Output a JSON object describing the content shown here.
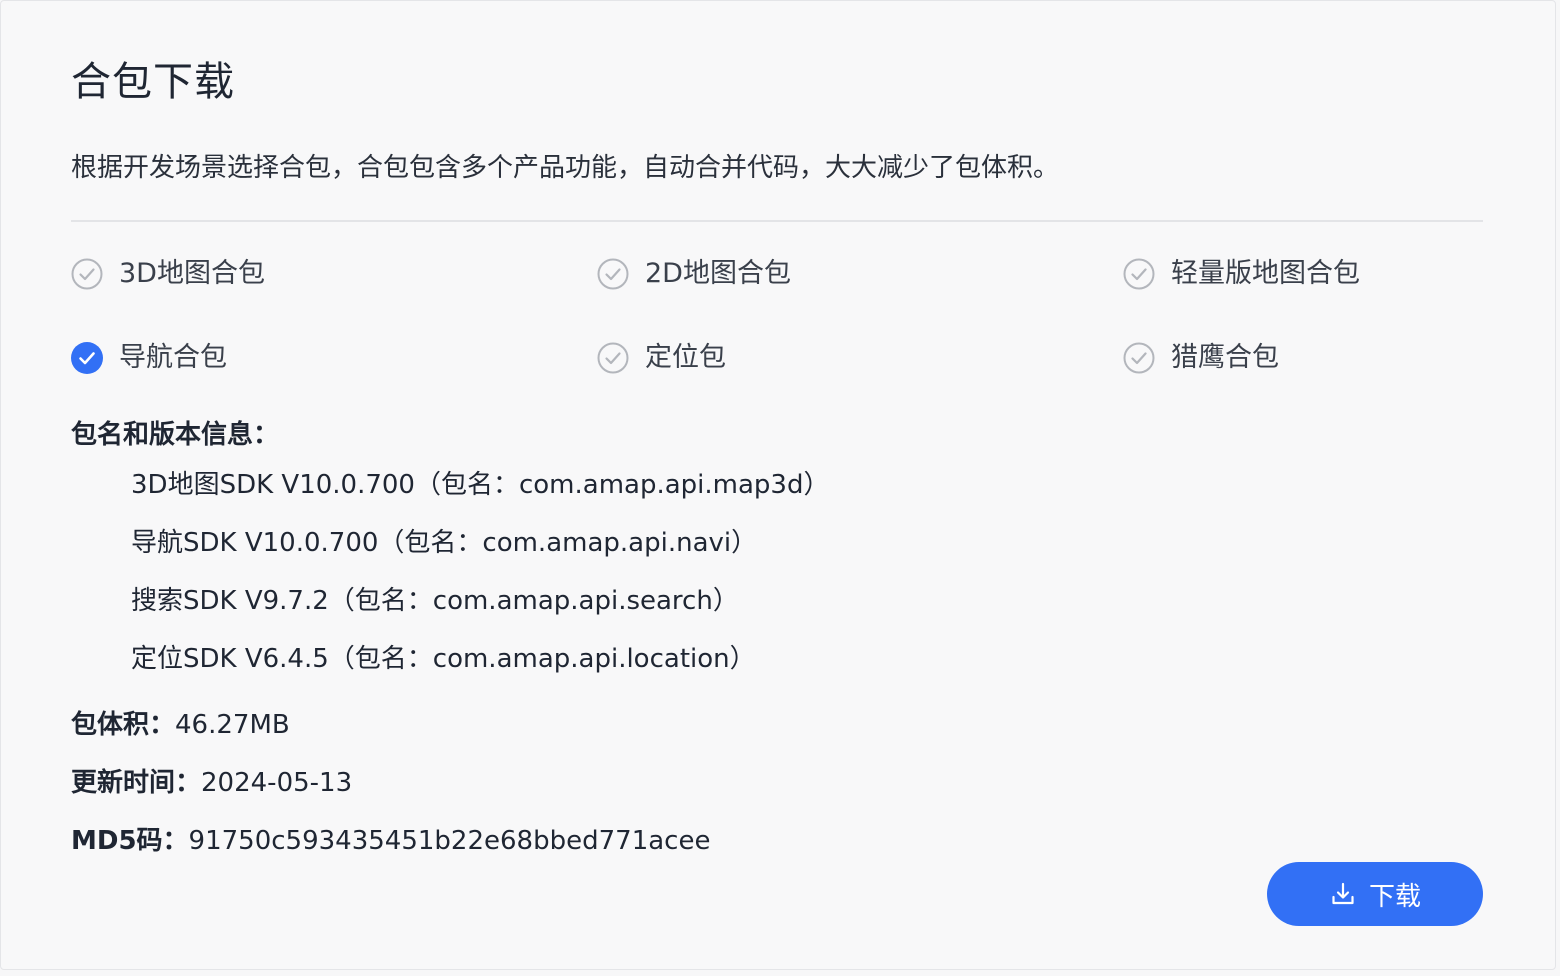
{
  "header": {
    "title": "合包下载",
    "description": "根据开发场景选择合包，合包包含多个产品功能，自动合并代码，大大减少了包体积。"
  },
  "options": [
    {
      "label": "3D地图合包",
      "checked": false,
      "icon": "check-circle-outline-icon"
    },
    {
      "label": "2D地图合包",
      "checked": false,
      "icon": "check-circle-outline-icon"
    },
    {
      "label": "轻量版地图合包",
      "checked": false,
      "icon": "check-circle-outline-icon"
    },
    {
      "label": "导航合包",
      "checked": true,
      "icon": "check-circle-filled-icon"
    },
    {
      "label": "定位包",
      "checked": false,
      "icon": "check-circle-outline-icon"
    },
    {
      "label": "猎鹰合包",
      "checked": false,
      "icon": "check-circle-outline-icon"
    }
  ],
  "package_info": {
    "heading": "包名和版本信息：",
    "sdks": [
      "3D地图SDK V10.0.700（包名：com.amap.api.map3d）",
      "导航SDK V10.0.700（包名：com.amap.api.navi）",
      "搜索SDK V9.7.2（包名：com.amap.api.search）",
      "定位SDK V6.4.5（包名：com.amap.api.location）"
    ]
  },
  "size": {
    "label": "包体积：",
    "value": "46.27MB"
  },
  "updated": {
    "label": "更新时间：",
    "value": "2024-05-13"
  },
  "md5": {
    "label": "MD5码：",
    "value": "91750c593435451b22e68bbed771acee"
  },
  "download": {
    "label": "下载",
    "icon": "download-icon"
  },
  "colors": {
    "accent": "#3270f5",
    "unchecked_icon": "#b3b6bc",
    "text": "#1f2633"
  }
}
